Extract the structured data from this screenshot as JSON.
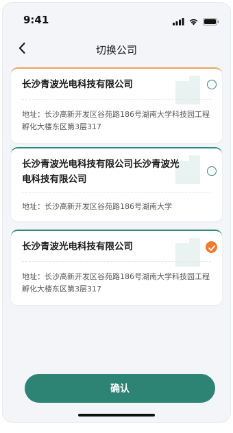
{
  "status_bar": {
    "time": "9:41",
    "icons": [
      "signal-icon",
      "wifi-icon",
      "battery-icon"
    ]
  },
  "nav": {
    "back_icon": "chevron-left-icon",
    "title": "切换公司"
  },
  "companies": [
    {
      "name": "长沙青波光电科技有限公司",
      "address": "地址：长沙高新开发区谷苑路186号湖南大学科技园工程孵化大楼东区第3层317",
      "selected": false
    },
    {
      "name": "长沙青波光电科技有限公司长沙青波光电科技有限公司",
      "address": "地址：长沙高新开发区谷苑路186号湖南大学",
      "selected": false
    },
    {
      "name": "长沙青波光电科技有限公司",
      "address": "地址：长沙高新开发区谷苑路186号湖南大学科技园工程孵化大楼东区第3层317",
      "selected": true
    }
  ],
  "confirm_label": "确认",
  "colors": {
    "accent": "#2d8475",
    "selected": "#f07a2e",
    "first_card_top": "#f2a25c",
    "background": "#f3f5f8"
  }
}
